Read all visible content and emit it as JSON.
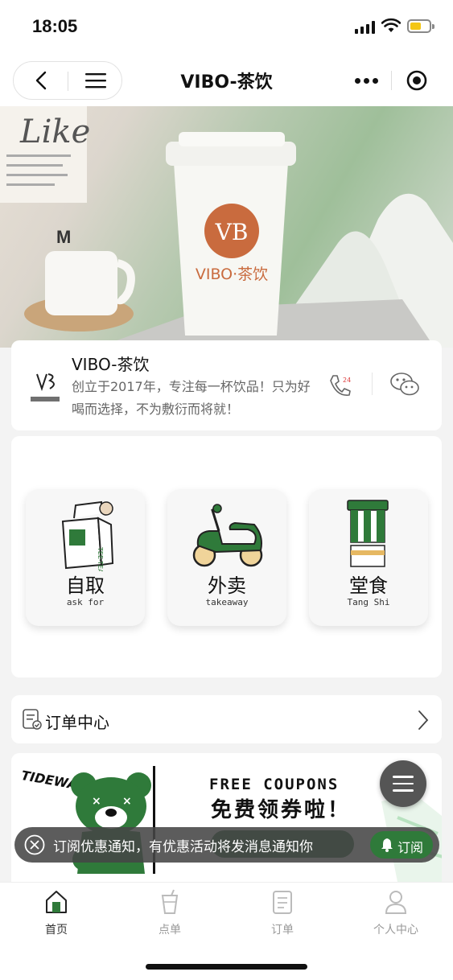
{
  "status_bar": {
    "time": "18:05"
  },
  "nav": {
    "title": "VIBO-茶饮"
  },
  "hero": {
    "cup_brand": "VIBO·茶饮"
  },
  "store": {
    "name": "VIBO-茶饮",
    "description": "创立于2017年，专注每一杯饮品！只为好喝而选择，不为敷衍而将就！"
  },
  "modes": [
    {
      "label": "自取",
      "sub": "ask for"
    },
    {
      "label": "外卖",
      "sub": "takeaway"
    },
    {
      "label": "堂食",
      "sub": "Tang Shi"
    }
  ],
  "order_center": {
    "label": "订单中心"
  },
  "coupon": {
    "brand": "TIDEWA",
    "headline_en": "FREE COUPONS",
    "headline_cn": "免费领券啦！"
  },
  "toast": {
    "text": "订阅优惠通知，有优惠活动将发消息通知你",
    "button": "订阅"
  },
  "tabs": [
    {
      "label": "首页",
      "active": true
    },
    {
      "label": "点单",
      "active": false
    },
    {
      "label": "订单",
      "active": false
    },
    {
      "label": "个人中心",
      "active": false
    }
  ],
  "colors": {
    "accent": "#2f7a3a",
    "tile_bg": "#f7f7f7",
    "page_bg": "#f3f3f3"
  }
}
